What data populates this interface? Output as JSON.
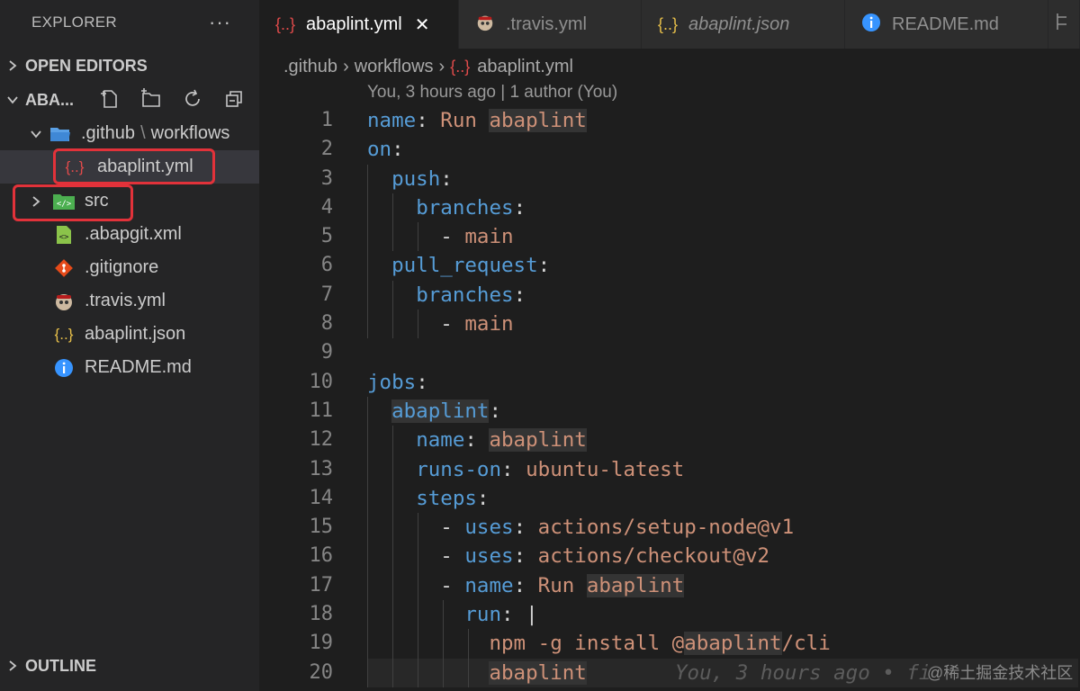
{
  "explorer": {
    "title": "EXPLORER",
    "more": "···",
    "sections": {
      "open_editors": "OPEN EDITORS",
      "workspace": "ABA...",
      "outline": "OUTLINE"
    }
  },
  "tree": {
    "folder_github": ".github",
    "folder_workflows": "workflows",
    "file_abaplint_yml": "abaplint.yml",
    "folder_src": "src",
    "file_abapgit": ".abapgit.xml",
    "file_gitignore": ".gitignore",
    "file_travis": ".travis.yml",
    "file_abaplint_json": "abaplint.json",
    "file_readme": "README.md"
  },
  "icons": {
    "yaml": "{..}",
    "json": "{..}",
    "info": "i",
    "folder": "folder-icon",
    "src": "</>"
  },
  "tabs": [
    {
      "label": "abaplint.yml"
    },
    {
      "label": ".travis.yml"
    },
    {
      "label": "abaplint.json"
    },
    {
      "label": "README.md"
    }
  ],
  "breadcrumb": {
    "seg1": ".github",
    "seg2": "workflows",
    "seg3": "abaplint.yml"
  },
  "codelens": "You, 3 hours ago | 1 author (You)",
  "editor": {
    "line_numbers": [
      "1",
      "2",
      "3",
      "4",
      "5",
      "6",
      "7",
      "8",
      "9",
      "10",
      "11",
      "12",
      "13",
      "14",
      "15",
      "16",
      "17",
      "18",
      "19",
      "20"
    ],
    "blame": "You, 3 hours ago • fi"
  },
  "code": {
    "name": "name",
    "colon": ":",
    "run_word": "Run",
    "abaplint": "abaplint",
    "on": "on",
    "push": "push",
    "branches": "branches",
    "dash": "- ",
    "main": "main",
    "pull_request": "pull_request",
    "jobs": "jobs",
    "runs_on": "runs-on",
    "ubuntu": "ubuntu-latest",
    "steps": "steps",
    "uses": "uses",
    "setup_node": "actions/setup-node@v1",
    "checkout": "actions/checkout@v2",
    "run": "run",
    "pipe": "|",
    "npm": "npm -g install @",
    "cli": "/cli"
  },
  "watermark": "@稀土掘金技术社区",
  "colors": {
    "accent_red": "#e2323a",
    "keyword": "#569cd6",
    "string": "#ce9178",
    "yaml_icon": "#e24b4b",
    "json_icon": "#e8c04a",
    "info_icon": "#3794ff"
  }
}
